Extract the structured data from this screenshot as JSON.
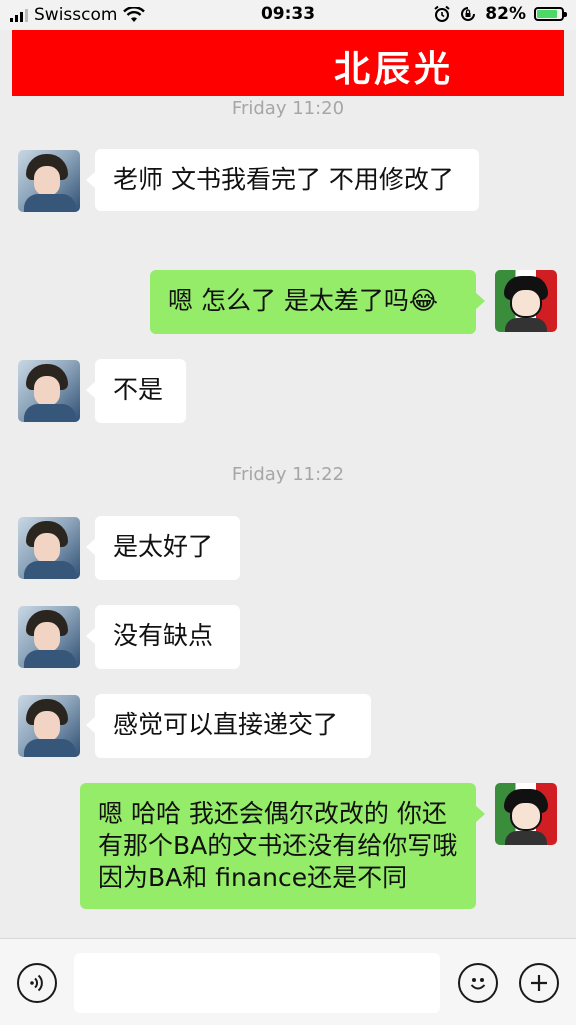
{
  "status_bar": {
    "carrier": "Swisscom",
    "time": "09:33",
    "battery_percent": "82%",
    "battery_level": 0.82
  },
  "header": {
    "title": "北辰光",
    "banner_color": "#fe0000"
  },
  "timestamps": [
    "Friday 11:20",
    "Friday 11:22"
  ],
  "messages": [
    {
      "side": "in",
      "text": "老师  文书我看完了  不用修改了"
    },
    {
      "side": "out",
      "text": "嗯 怎么了 是太差了吗😂"
    },
    {
      "side": "in",
      "text": "不是"
    },
    {
      "side": "in",
      "text": "是太好了"
    },
    {
      "side": "in",
      "text": "没有缺点"
    },
    {
      "side": "in",
      "text": "感觉可以直接递交了"
    },
    {
      "side": "out",
      "text": "嗯 哈哈 我还会偶尔改改的  你还有那个BA的文书还没有给你写哦 因为BA和 finance还是不同"
    }
  ],
  "input_bar": {
    "voice_icon": "voice-icon",
    "emoji_icon": "emoji-icon",
    "add_icon": "plus-icon"
  },
  "colors": {
    "outgoing_bubble": "#95ec69",
    "incoming_bubble": "#ffffff",
    "background": "#ededed"
  }
}
